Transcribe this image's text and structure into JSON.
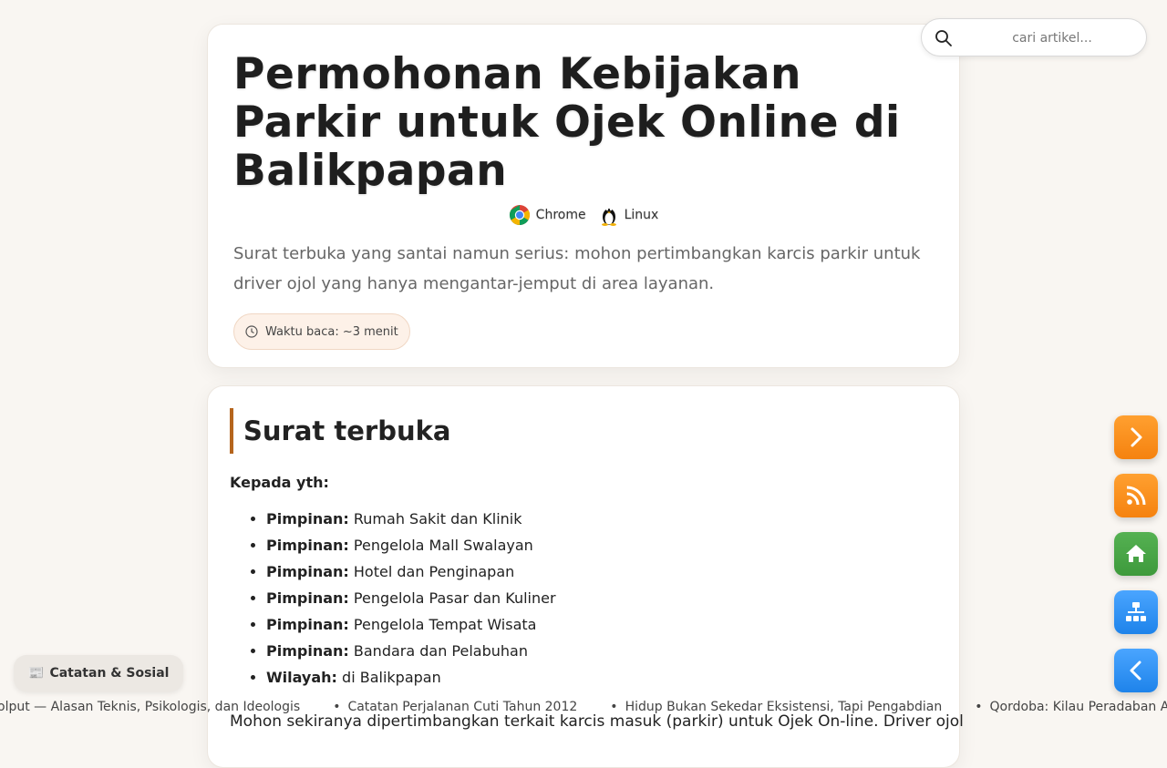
{
  "hero": {
    "title": "Permohonan Kebijakan Parkir untuk Ojek Online di Balikpapan",
    "env": [
      {
        "icon": "chrome-icon",
        "label": "Chrome"
      },
      {
        "icon": "linux-tux-icon",
        "label": "Linux"
      }
    ],
    "subtitle": "Surat terbuka yang santai namun serius: mohon pertimbangkan karcis parkir untuk driver ojol yang hanya mengantar-jemput di area layanan.",
    "reading_time": "Waktu baca: ~3 menit"
  },
  "article": {
    "heading": "Surat terbuka",
    "kepada": "Kepada yth:",
    "recipients": [
      {
        "role": "Pimpinan:",
        "name": "Rumah Sakit dan Klinik"
      },
      {
        "role": "Pimpinan:",
        "name": "Pengelola Mall Swalayan"
      },
      {
        "role": "Pimpinan:",
        "name": "Hotel dan Penginapan"
      },
      {
        "role": "Pimpinan:",
        "name": "Pengelola Pasar dan Kuliner"
      },
      {
        "role": "Pimpinan:",
        "name": "Pengelola Tempat Wisata"
      },
      {
        "role": "Pimpinan:",
        "name": "Bandara dan Pelabuhan"
      },
      {
        "role": "Wilayah:",
        "name": "di Balikpapan"
      }
    ],
    "paragraph": "Mohon sekiranya dipertimbangkan terkait karcis masuk (parkir) untuk Ojek On-line. Driver ojol"
  },
  "search": {
    "placeholder": "cari artikel..."
  },
  "fabs": [
    {
      "name": "next-button",
      "icon": "chevron-right-icon",
      "color": "#f7891a"
    },
    {
      "name": "rss-button",
      "icon": "rss-icon",
      "color": "#f7891a"
    },
    {
      "name": "home-button",
      "icon": "home-icon",
      "color": "#47a544"
    },
    {
      "name": "sitemap-button",
      "icon": "sitemap-icon",
      "color": "#2b8df2"
    },
    {
      "name": "back-button",
      "icon": "chevron-left-icon",
      "color": "#2b8df2"
    }
  ],
  "social_button": {
    "icon": "newspaper-icon",
    "label": "Catatan & Sosial"
  },
  "ticker": [
    "olput — Alasan Teknis, Psikologis, dan Ideologis",
    "Catatan Perjalanan Cuti Tahun 2012",
    "Hidup Bukan Sekedar Eksistensi, Tapi Pengabdian",
    "Qordoba: Kilau Peradaban Andalusia"
  ],
  "colors": {
    "accent": "#b5651d",
    "background": "#f9f6f2",
    "orange": "#f7891a",
    "green": "#47a544",
    "blue": "#2b8df2"
  }
}
